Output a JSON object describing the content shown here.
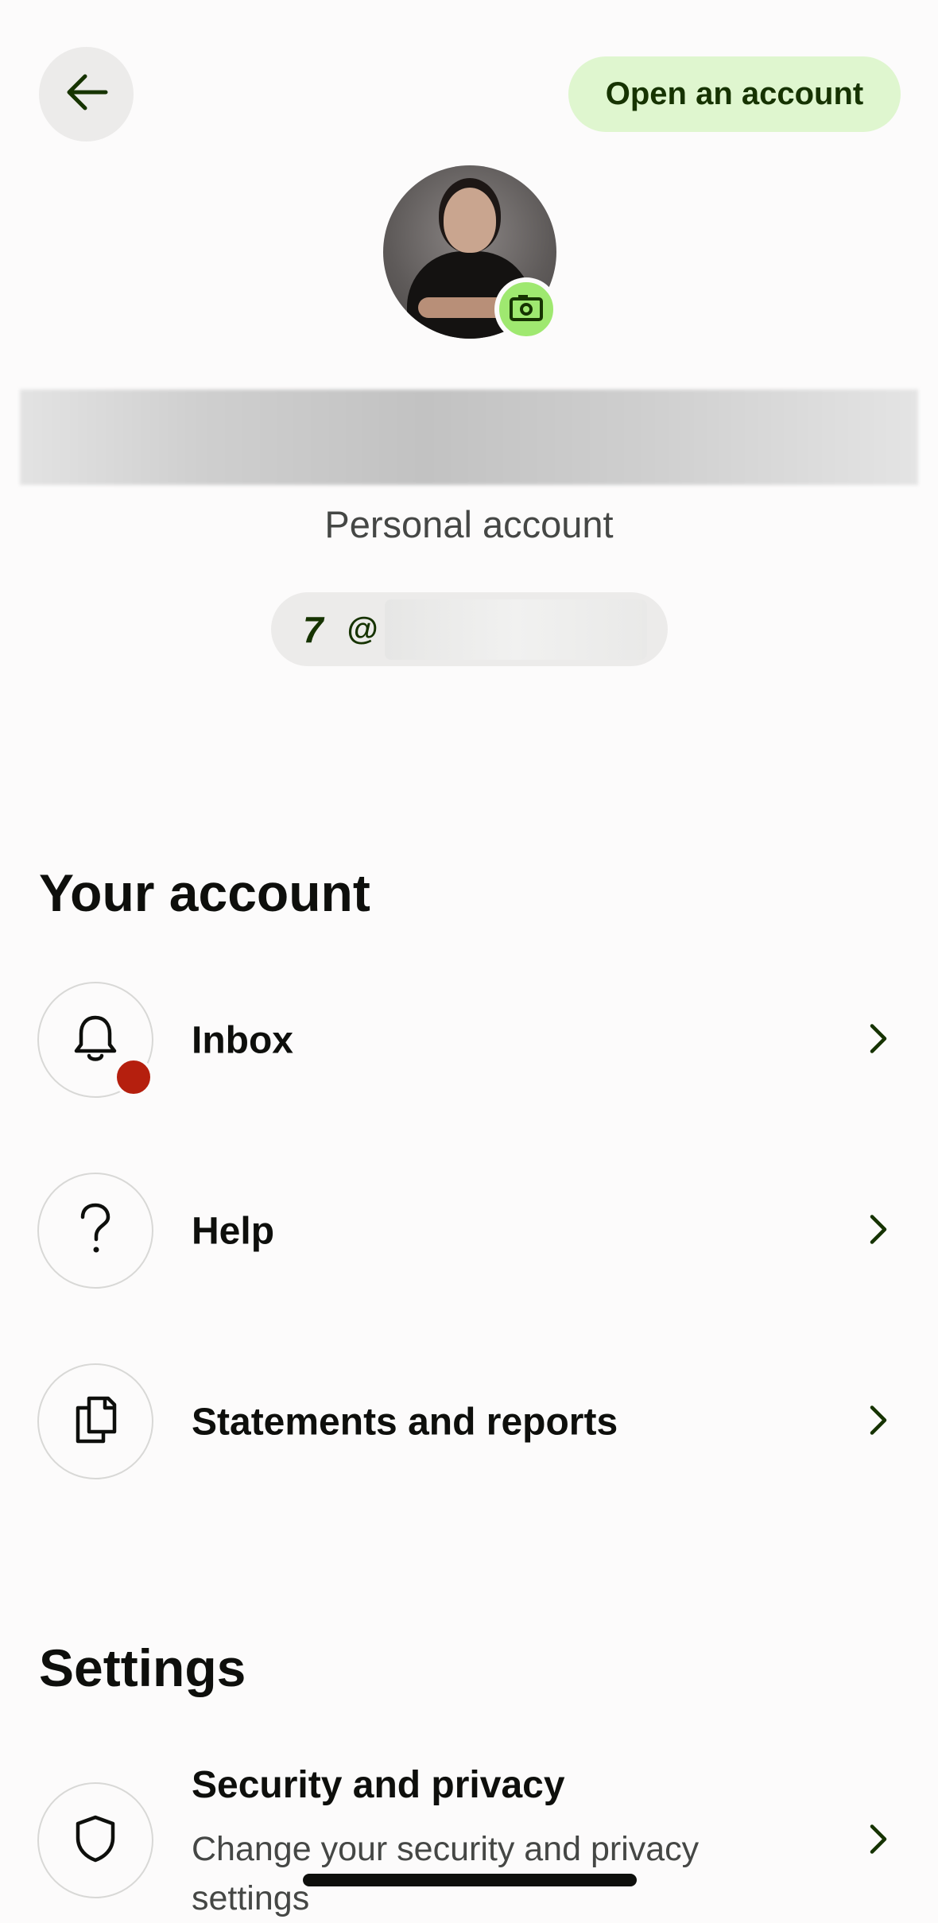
{
  "header": {
    "back_icon": "arrow-left-icon",
    "open_account_label": "Open an account"
  },
  "profile": {
    "avatar_alt": "profile-photo",
    "camera_icon": "camera-icon",
    "account_type": "Personal account",
    "handle_prefix": "@",
    "brand_glyph": "7"
  },
  "your_account": {
    "title": "Your account",
    "items": [
      {
        "label": "Inbox",
        "icon": "bell-icon",
        "has_notification": true
      },
      {
        "label": "Help",
        "icon": "question-icon"
      },
      {
        "label": "Statements and reports",
        "icon": "documents-icon"
      }
    ]
  },
  "settings": {
    "title": "Settings",
    "items": [
      {
        "label": "Security and privacy",
        "subtitle": "Change your security and privacy settings",
        "icon": "shield-icon"
      }
    ]
  },
  "colors": {
    "accent_green": "#9fe870",
    "pill_green": "#dff6cf",
    "forest_green": "#163300",
    "notification_red": "#b51f0e"
  }
}
